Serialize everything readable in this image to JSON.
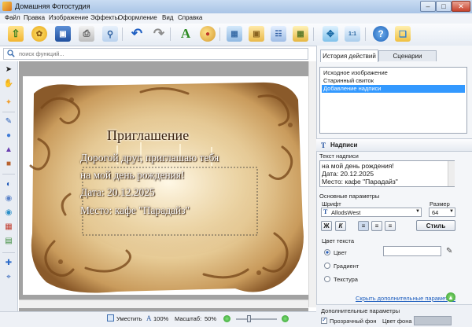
{
  "window": {
    "title": "Домашняя Фотостудия"
  },
  "menu": [
    "Файл",
    "Правка",
    "Изображение",
    "Эффекты",
    "Оформление",
    "Вид",
    "Справка"
  ],
  "search": {
    "placeholder": "поиск функций..."
  },
  "canvas": {
    "title_text": "Приглашение",
    "lines": [
      "Дорогой друг, приглашаю тебя",
      "на мой день рождения!",
      "Дата: 20.12.2025",
      "Место: кафе \"Парадайз\""
    ]
  },
  "status": {
    "fit_label": "Уместить",
    "zoom_100": "100%",
    "scale_label": "Масштаб:",
    "scale_value": "50%"
  },
  "panel": {
    "tabs": [
      "История действий",
      "Сценарии"
    ],
    "history": [
      "Исходное изображение",
      "Старинный свиток",
      "Добавление надписи"
    ],
    "history_selected": 2,
    "caption_title": "Надписи",
    "text_label": "Текст надписи",
    "text_lines": [
      "на мой день рождения!",
      "Дата: 20.12.2025",
      "Место: кафе \"Парадайз\""
    ],
    "basic_params": "Основные параметры",
    "font_label": "Шрифт",
    "size_label": "Размер",
    "font_value": "AllodsWest",
    "size_value": "64",
    "bold_btn": "Ж",
    "italic_btn": "К",
    "style_btn": "Стиль",
    "text_color_label": "Цвет текста",
    "radio_color": "Цвет",
    "radio_gradient": "Градиент",
    "radio_texture": "Текстура",
    "hide_params_link": "Скрыть дополнительные параметры",
    "extra_params": "Дополнительные параметры",
    "transparent_bg": "Прозрачный фон",
    "bg_color": "Цвет фона"
  },
  "colors": {
    "accent": "#3399ff",
    "selection": "#3399ff",
    "parchment": "#e8cd98"
  }
}
